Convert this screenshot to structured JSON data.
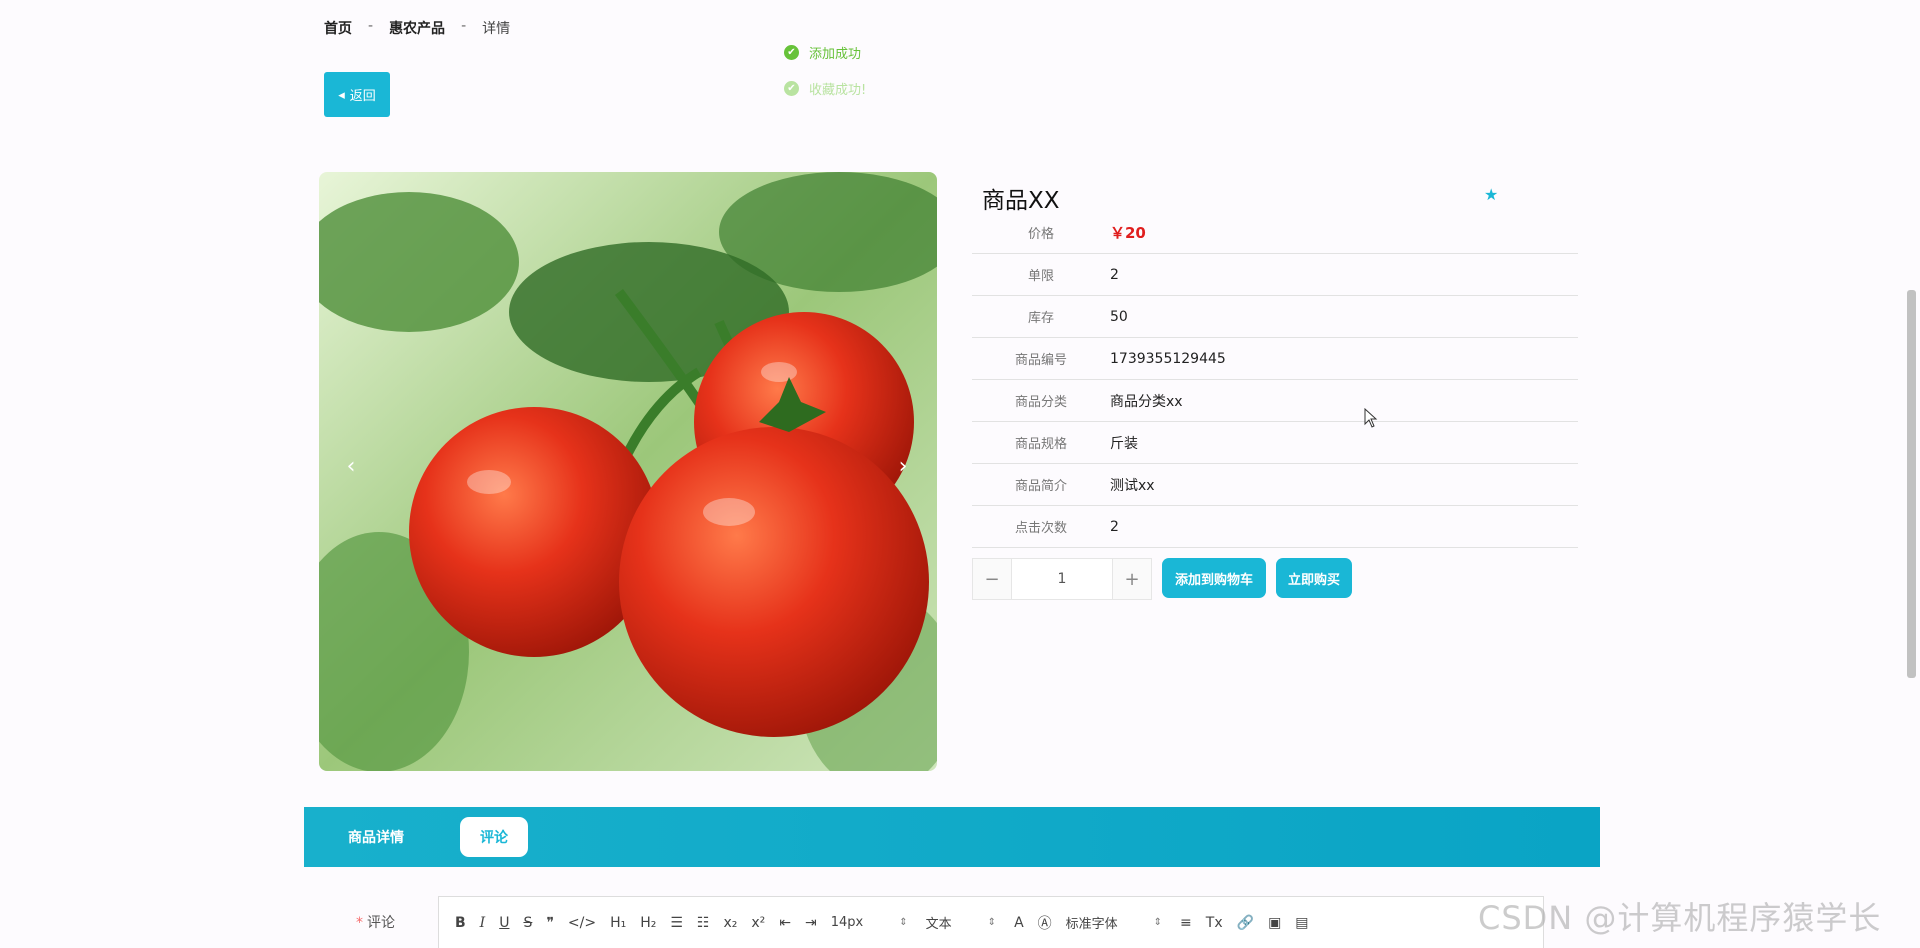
{
  "breadcrumb": {
    "home": "首页",
    "sep1": "-",
    "category": "惠农产品",
    "sep2": "-",
    "current": "详情"
  },
  "toasts": [
    {
      "text": "添加成功",
      "icon": "check-circle-icon"
    },
    {
      "text": "收藏成功!",
      "icon": "check-circle-icon"
    }
  ],
  "back_button": {
    "label": "返回",
    "icon": "caret-left-icon"
  },
  "carousel": {
    "prev": "‹",
    "next": "›",
    "image": "tomatoes-photo"
  },
  "product": {
    "title": "商品XX",
    "favorite_icon": "star-icon",
    "attributes": [
      {
        "label": "价格",
        "value": "￥20"
      },
      {
        "label": "单限",
        "value": "2"
      },
      {
        "label": "库存",
        "value": "50"
      },
      {
        "label": "商品编号",
        "value": "1739355129445"
      },
      {
        "label": "商品分类",
        "value": "商品分类xx"
      },
      {
        "label": "商品规格",
        "value": "斤装"
      },
      {
        "label": "商品简介",
        "value": "测试xx"
      },
      {
        "label": "点击次数",
        "value": "2"
      }
    ]
  },
  "quantity": {
    "minus": "−",
    "value": "1",
    "plus": "+"
  },
  "actions": {
    "add_to_cart": "添加到购物车",
    "buy_now": "立即购买"
  },
  "tabs": [
    {
      "label": "商品详情"
    },
    {
      "label": "评论"
    }
  ],
  "comment": {
    "required_mark": "*",
    "label": "评论"
  },
  "toolbar": {
    "bold": "B",
    "italic": "I",
    "underline": "U",
    "strike": "S",
    "quote": "❞",
    "code": "</>",
    "h1": "H₁",
    "h2": "H₂",
    "ordered_list": "☰",
    "bullet_list": "☷",
    "subscript": "x₂",
    "superscript": "x²",
    "outdent": "⇤",
    "indent": "⇥",
    "size": "14px",
    "header": "文本",
    "color": "A",
    "background": "Ⓐ",
    "font": "标准字体",
    "align": "≡",
    "clean": "Tx",
    "link": "🔗",
    "image": "▣",
    "video": "▤"
  },
  "watermark": "CSDN @计算机程序猿学长",
  "colors": {
    "accent": "#1ab7d6",
    "price": "#e01e1e",
    "success": "#67c23a"
  }
}
